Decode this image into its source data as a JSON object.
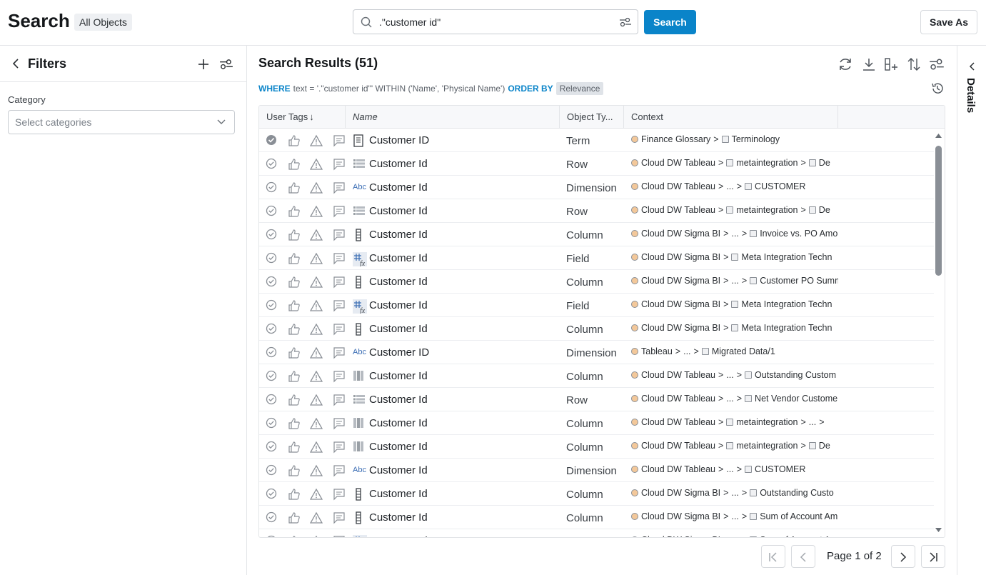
{
  "header": {
    "title": "Search",
    "scope_badge": "All Objects",
    "search_value": ".\"customer id\"",
    "search_button": "Search",
    "save_as_button": "Save As"
  },
  "filters": {
    "title": "Filters",
    "category_label": "Category",
    "category_placeholder": "Select categories"
  },
  "results": {
    "title": "Search Results (51)",
    "query": {
      "where_kw": "WHERE",
      "where_text": "text = '.\"customer id\"' WITHIN ('Name', 'Physical Name')",
      "order_kw": "ORDER BY",
      "order_value": "Relevance"
    },
    "columns": [
      "User Tags",
      "Name",
      "Object Ty...",
      "Context"
    ],
    "rows": [
      {
        "icon": "term-icon",
        "name": "Customer ID",
        "type": "Term",
        "ctx": [
          "Finance Glossary",
          ">",
          "Terminology"
        ],
        "checked": true
      },
      {
        "icon": "row-icon",
        "name": "Customer Id",
        "type": "Row",
        "ctx": [
          "Cloud DW Tableau",
          ">",
          "metaintegration",
          ">",
          "De"
        ]
      },
      {
        "icon": "dimension-icon",
        "name": "Customer Id",
        "type": "Dimension",
        "ctx": [
          "Cloud DW Tableau",
          ">",
          "...",
          ">",
          "CUSTOMER"
        ]
      },
      {
        "icon": "row-icon",
        "name": "Customer Id",
        "type": "Row",
        "ctx": [
          "Cloud DW Tableau",
          ">",
          "metaintegration",
          ">",
          "De"
        ]
      },
      {
        "icon": "column-icon",
        "name": "Customer Id",
        "type": "Column",
        "ctx": [
          "Cloud DW Sigma BI",
          ">",
          "...",
          ">",
          "Invoice vs. PO Amo"
        ]
      },
      {
        "icon": "field-icon",
        "name": "Customer Id",
        "type": "Field",
        "ctx": [
          "Cloud DW Sigma BI",
          ">",
          "Meta Integration Techn"
        ]
      },
      {
        "icon": "column-icon",
        "name": "Customer Id",
        "type": "Column",
        "ctx": [
          "Cloud DW Sigma BI",
          ">",
          "...",
          ">",
          "Customer PO Summ"
        ]
      },
      {
        "icon": "field-icon",
        "name": "Customer Id",
        "type": "Field",
        "ctx": [
          "Cloud DW Sigma BI",
          ">",
          "Meta Integration Techn"
        ]
      },
      {
        "icon": "column-icon",
        "name": "Customer Id",
        "type": "Column",
        "ctx": [
          "Cloud DW Sigma BI",
          ">",
          "Meta Integration Techn"
        ]
      },
      {
        "icon": "dimension-icon",
        "name": "Customer ID",
        "type": "Dimension",
        "ctx": [
          "Tableau",
          ">",
          "...",
          ">",
          "Migrated Data/1"
        ]
      },
      {
        "icon": "table-column-icon",
        "name": "Customer Id",
        "type": "Column",
        "ctx": [
          "Cloud DW Tableau",
          ">",
          "...",
          ">",
          "Outstanding Custom"
        ]
      },
      {
        "icon": "row-icon",
        "name": "Customer Id",
        "type": "Row",
        "ctx": [
          "Cloud DW Tableau",
          ">",
          "...",
          ">",
          "Net Vendor Custome"
        ]
      },
      {
        "icon": "table-column-icon",
        "name": "Customer Id",
        "type": "Column",
        "ctx": [
          "Cloud DW Tableau",
          ">",
          "metaintegration",
          ">",
          "...",
          ">"
        ]
      },
      {
        "icon": "table-column-icon",
        "name": "Customer Id",
        "type": "Column",
        "ctx": [
          "Cloud DW Tableau",
          ">",
          "metaintegration",
          ">",
          "De"
        ]
      },
      {
        "icon": "dimension-icon",
        "name": "Customer Id",
        "type": "Dimension",
        "ctx": [
          "Cloud DW Tableau",
          ">",
          "...",
          ">",
          "CUSTOMER"
        ]
      },
      {
        "icon": "column-icon",
        "name": "Customer Id",
        "type": "Column",
        "ctx": [
          "Cloud DW Sigma BI",
          ">",
          "...",
          ">",
          "Outstanding Custo"
        ]
      },
      {
        "icon": "column-icon",
        "name": "Customer Id",
        "type": "Column",
        "ctx": [
          "Cloud DW Sigma BI",
          ">",
          "...",
          ">",
          "Sum of Account Am"
        ]
      },
      {
        "icon": "field-icon",
        "name": "Customer Id",
        "type": "Field",
        "ctx": [
          "Cloud DW Sigma BI",
          ">",
          "...",
          ">",
          "Sum of Account Am"
        ]
      }
    ],
    "pagination": "Page 1 of 2"
  },
  "details": {
    "label": "Details"
  },
  "colors": {
    "accent": "#0a84c9",
    "icon_gray": "#6b7178",
    "border": "#e3e5e8"
  }
}
